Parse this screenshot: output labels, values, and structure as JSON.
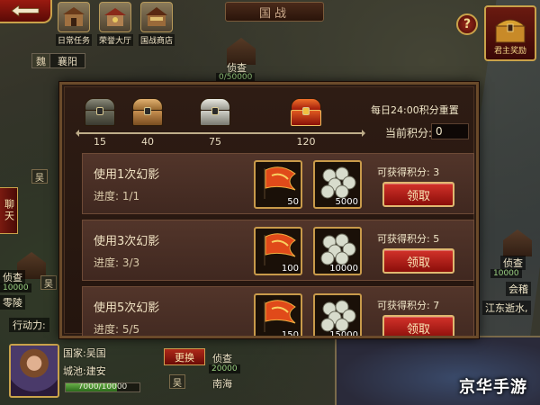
{
  "top": {
    "title": "国战",
    "buttons": [
      {
        "label": "日常任务",
        "icon": "daily-quest-icon"
      },
      {
        "label": "荣誉大厅",
        "icon": "honor-hall-icon"
      },
      {
        "label": "国战商店",
        "icon": "war-shop-icon"
      }
    ],
    "help": "?",
    "reward_label": "君主奖励"
  },
  "map": {
    "region_kingdom": "魏",
    "region_city": "襄阳",
    "scout_top": {
      "label": "侦查",
      "value": "0/50000"
    },
    "left_city": "零陵",
    "left_scout": "侦查",
    "left_scout_value": "10000",
    "chat_label": "聊天",
    "right_scout": {
      "label": "侦查",
      "value": "10000"
    },
    "right_city": "会稽",
    "right_region": "江东逝水,",
    "wu": "吴"
  },
  "status": {
    "action_label": "行动力:",
    "country": "国家:吴国",
    "city": "城池:建安",
    "hp": "7000/10000",
    "hp_fraction": 0.7,
    "swap_label": "更换",
    "bottom_scout": "侦查",
    "bottom_scout_value": "20000",
    "bottom_city": "南海",
    "wu2": "吴"
  },
  "panel": {
    "reset_text": "每日24:00积分重置",
    "score_label": "当前积分:",
    "score_value": "0",
    "milestones": [
      {
        "value": "15",
        "color": "silver-dark"
      },
      {
        "value": "40",
        "color": "bronze"
      },
      {
        "value": "75",
        "color": "silver"
      },
      {
        "value": "120",
        "color": "red-gold"
      }
    ],
    "tasks": [
      {
        "title": "使用1次幻影",
        "progress": "进度: 1/1",
        "earn": "可获得积分: 3",
        "item1_qty": "50",
        "item2_qty": "5000",
        "claim": "领取"
      },
      {
        "title": "使用3次幻影",
        "progress": "进度: 3/3",
        "earn": "可获得积分: 5",
        "item1_qty": "100",
        "item2_qty": "10000",
        "claim": "领取"
      },
      {
        "title": "使用5次幻影",
        "progress": "进度: 5/5",
        "earn": "可获得积分: 7",
        "item1_qty": "150",
        "item2_qty": "15000",
        "claim": "领取"
      }
    ]
  },
  "watermark": "京华手游"
}
